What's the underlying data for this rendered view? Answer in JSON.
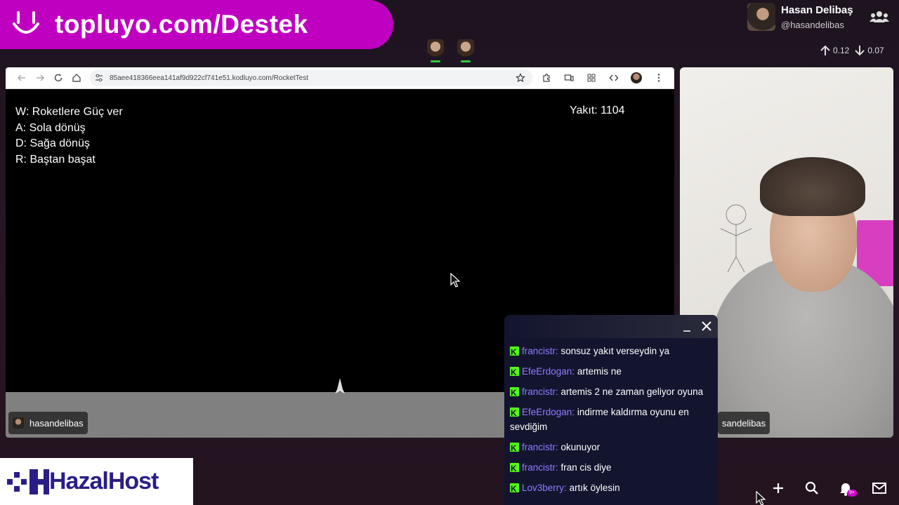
{
  "banner": {
    "text": "topluyo.com/Destek"
  },
  "profile": {
    "name": "Hasan Delibaş",
    "handle": "@hasandelibas"
  },
  "stats": {
    "up": "0.12",
    "down": "0.07"
  },
  "browser": {
    "url": "85aee418366eea141af9d922cf741e51.kodluyo.com/RocketTest"
  },
  "game": {
    "controls": [
      "W: Roketlere Güç ver",
      "A: Sola dönüş",
      "D: Sağa dönüş",
      "R: Baştan başat"
    ],
    "fuel": "Yakıt: 1104"
  },
  "screen_tag": "hasandelibas",
  "cam_tag": "sandelibas",
  "chat": {
    "messages": [
      {
        "user": "francistr:",
        "text": "sonsuz yakıt verseydin ya"
      },
      {
        "user": "EfeErdogan:",
        "text": "artemis ne"
      },
      {
        "user": "francistr:",
        "text": "artemis 2 ne zaman geliyor oyuna"
      },
      {
        "user": "EfeErdogan:",
        "text": "indirme kaldırma oyunu en sevdiğim"
      },
      {
        "user": "francistr:",
        "text": "okunuyor"
      },
      {
        "user": "francistr:",
        "text": "fran cis diye"
      },
      {
        "user": "Lov3berry:",
        "text": "artık öylesin"
      }
    ]
  },
  "sponsor": {
    "text": "HazalHost"
  },
  "notifications": {
    "badge": "9+"
  },
  "icons": [
    "people-icon",
    "arrow-up-icon",
    "arrow-down-icon",
    "plus-icon",
    "search-icon",
    "bell-icon",
    "mail-icon"
  ],
  "colors": {
    "banner": "#c000c0",
    "chat_user": "#8f7cff",
    "kick_green": "#53fc18",
    "sponsor_text": "#2a1e86"
  }
}
